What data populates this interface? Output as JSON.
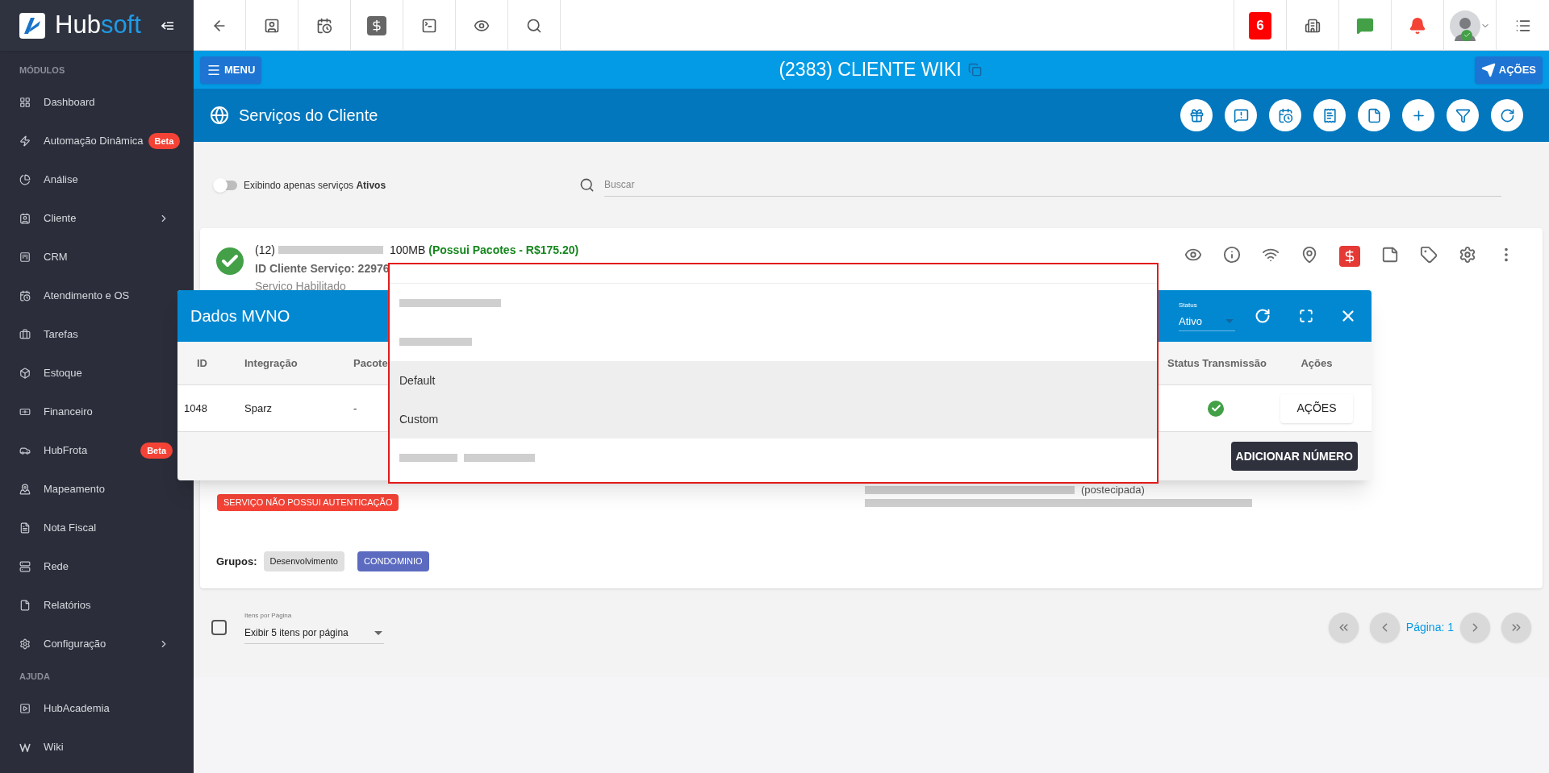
{
  "logo": {
    "part1": "Hub",
    "part2": "soft"
  },
  "sidebar": {
    "sections": [
      {
        "title": "MÓDULOS",
        "items": [
          {
            "label": "Dashboard"
          },
          {
            "label": "Automação Dinâmica",
            "badge": "Beta"
          },
          {
            "label": "Análise"
          },
          {
            "label": "Cliente",
            "expandable": true
          },
          {
            "label": "CRM"
          },
          {
            "label": "Atendimento e OS"
          },
          {
            "label": "Tarefas"
          },
          {
            "label": "Estoque"
          },
          {
            "label": "Financeiro"
          },
          {
            "label": "HubFrota",
            "badge": "Beta"
          },
          {
            "label": "Mapeamento"
          },
          {
            "label": "Nota Fiscal"
          },
          {
            "label": "Rede"
          },
          {
            "label": "Relatórios"
          },
          {
            "label": "Configuração",
            "expandable": true
          }
        ]
      },
      {
        "title": "AJUDA",
        "items": [
          {
            "label": "HubAcademia"
          },
          {
            "label": "Wiki"
          }
        ]
      }
    ]
  },
  "topbar": {
    "notification_count": "6"
  },
  "client_bar": {
    "menu": "MENU",
    "title": "(2383) CLIENTE WIKI",
    "actions": "AÇÕES"
  },
  "section": {
    "title": "Serviços do Cliente"
  },
  "filter": {
    "toggle": {
      "label": "Exibindo apenas serviços **Ativos**",
      "on": false
    },
    "search": {
      "placeholder": "Buscar"
    }
  },
  "service": {
    "active": true,
    "prefix": "(12)",
    "speed": "100MB",
    "packages": "(Possui Pacotes - R$175.20)",
    "id_line": "ID Cliente Serviço: 22976",
    "status": "Servico Habilitado",
    "auth_badge": "SERVIÇO NÃO POSSUI AUTENTICAÇÃO",
    "billing": "(postecipada)",
    "groups_label": "Grupos:",
    "groups": [
      {
        "label": "Desenvolvimento",
        "color": "#e0e0e0"
      },
      {
        "label": "CONDOMINIO",
        "color": "#5c6bc0"
      }
    ]
  },
  "pagination": {
    "select_all": false,
    "per_page_label": "Itens por Página",
    "per_page": "Exibir 5 itens por página",
    "page": "Página: 1"
  },
  "modal": {
    "title": "Dados MVNO",
    "status_label": "Status",
    "status_value": "Ativo",
    "columns": [
      "ID",
      "Integração",
      "Pacote",
      "Status Transmissão",
      "Ações"
    ],
    "rows": [
      {
        "id": "1048",
        "integration": "Sparz",
        "package": "-",
        "transmitted": true,
        "action": "AÇÕES"
      }
    ],
    "add_button": "ADICIONAR NÚMERO"
  },
  "dropdown": {
    "options": [
      {
        "kind": "redacted",
        "selected": false
      },
      {
        "kind": "redacted",
        "selected": false
      },
      {
        "kind": "text",
        "label": "Default",
        "selected": true
      },
      {
        "kind": "text",
        "label": "Custom",
        "selected": true
      },
      {
        "kind": "redacted",
        "selected": false
      }
    ]
  }
}
